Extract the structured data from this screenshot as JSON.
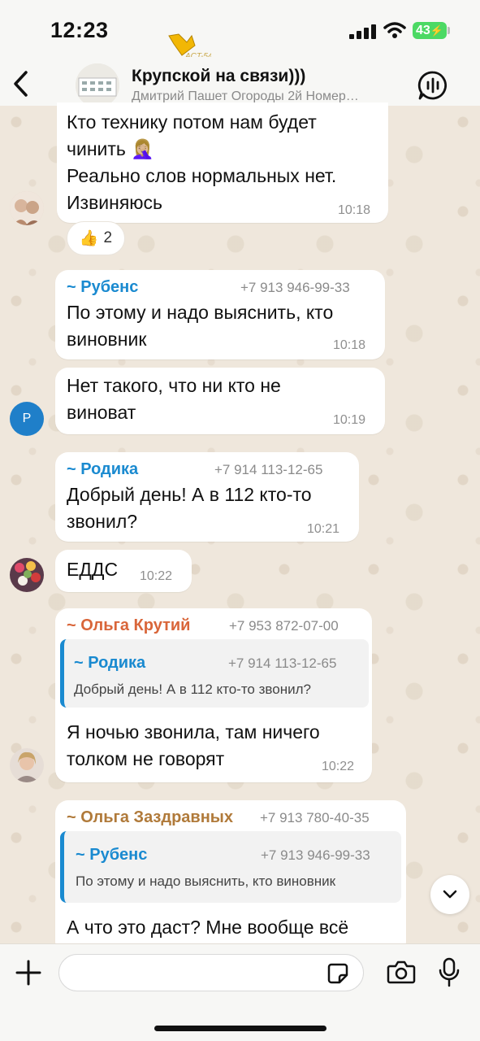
{
  "status": {
    "time": "12:23",
    "battery": "43"
  },
  "header": {
    "title": "Крупской на связи)))",
    "subtitle": "Дмитрий Пашет Огороды 2й Номер…"
  },
  "messages": [
    {
      "lines": [
        "Кто технику потом нам будет",
        "чинить 🤦🏼‍♀️",
        "Реально слов нормальных нет.",
        "Извиняюсь"
      ],
      "time": "10:18",
      "reaction": {
        "emoji": "👍",
        "count": "2"
      }
    },
    {
      "sender": "~ Рубенс",
      "sender_color": "#1a8ad0",
      "phone": "+7 913 946-99-33",
      "lines": [
        "По этому и надо выяснить, кто",
        "виновник"
      ],
      "time": "10:18"
    },
    {
      "avatar_letter": "Р",
      "lines": [
        "Нет такого, что ни кто не",
        "виноват"
      ],
      "time": "10:19"
    },
    {
      "sender": "~ Родика",
      "sender_color": "#1a8ad0",
      "phone": "+7 914 113-12-65",
      "lines": [
        "Добрый день! А в 112 кто-то",
        "звонил?"
      ],
      "time": "10:21"
    },
    {
      "lines": [
        "ЕДДС"
      ],
      "time": "10:22"
    },
    {
      "sender": "~ Ольга Крутий",
      "sender_color": "#d9663a",
      "phone": "+7 953 872-07-00",
      "quote": {
        "sender": "~ Родика",
        "phone": "+7 914 113-12-65",
        "text": "Добрый день! А в 112 кто-то звонил?"
      },
      "lines": [
        "Я ночью звонила, там ничего",
        "толком не говорят"
      ],
      "time": "10:22"
    },
    {
      "sender": "~ Ольга Заздравных",
      "sender_color": "#b07a3a",
      "phone": "+7 913 780-40-35",
      "quote": {
        "sender": "~ Рубенс",
        "phone": "+7 913 946-99-33",
        "text": "По этому и надо выяснить, кто виновник"
      },
      "lines": [
        "А что это даст? Мне вообще всё"
      ]
    }
  ],
  "colors": {
    "accent": "#1a8ad0",
    "battery": "#4cd964"
  }
}
